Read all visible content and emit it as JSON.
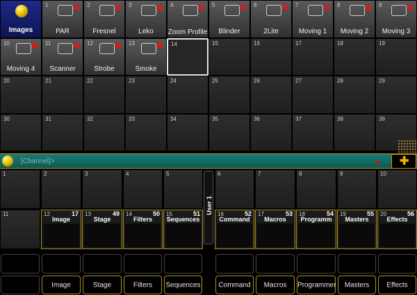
{
  "pool": {
    "images_label": "Images",
    "row1": [
      {
        "num": "1",
        "label": "PAR"
      },
      {
        "num": "2",
        "label": "Fresnel"
      },
      {
        "num": "3",
        "label": "Leko"
      },
      {
        "num": "4",
        "label": "Zoom Profile"
      },
      {
        "num": "5",
        "label": "Blinder"
      },
      {
        "num": "6",
        "label": "2Lite"
      },
      {
        "num": "7",
        "label": "Moving 1"
      },
      {
        "num": "8",
        "label": "Moving 2"
      },
      {
        "num": "9",
        "label": "Moving 3"
      }
    ],
    "row2": [
      {
        "num": "10",
        "label": "Moving 4"
      },
      {
        "num": "11",
        "label": "Scanner"
      },
      {
        "num": "12",
        "label": "Strobe"
      },
      {
        "num": "13",
        "label": "Smoke"
      },
      {
        "num": "14",
        "label": ""
      },
      {
        "num": "15",
        "label": ""
      },
      {
        "num": "16",
        "label": ""
      },
      {
        "num": "17",
        "label": ""
      },
      {
        "num": "18",
        "label": ""
      },
      {
        "num": "19",
        "label": ""
      }
    ],
    "row3": [
      "20",
      "21",
      "22",
      "23",
      "24",
      "25",
      "26",
      "27",
      "28",
      "29"
    ],
    "row4": [
      "30",
      "31",
      "32",
      "33",
      "34",
      "35",
      "36",
      "37",
      "38",
      "39"
    ]
  },
  "command_line": {
    "prompt": "[Channel]>"
  },
  "views_top": [
    "1",
    "2",
    "3",
    "4",
    "5",
    "6",
    "7",
    "8",
    "9",
    "10"
  ],
  "views_bottom": [
    {
      "num": "11",
      "title": "",
      "idx": ""
    },
    {
      "num": "12",
      "title": "Image",
      "idx": "17"
    },
    {
      "num": "13",
      "title": "Stage",
      "idx": "49"
    },
    {
      "num": "14",
      "title": "Filters",
      "idx": "50"
    },
    {
      "num": "15",
      "title": "Sequences",
      "idx": "51"
    },
    {
      "num": "16",
      "title": "Command",
      "idx": "52"
    },
    {
      "num": "17",
      "title": "Macros",
      "idx": "53"
    },
    {
      "num": "18",
      "title": "Programm",
      "idx": "54"
    },
    {
      "num": "19",
      "title": "Masters",
      "idx": "55"
    },
    {
      "num": "20",
      "title": "Effects",
      "idx": "56"
    }
  ],
  "user_label": "User 1",
  "bottom_buttons": [
    "",
    "Image",
    "Stage",
    "Filters",
    "Sequences",
    "Command",
    "Macros",
    "Programmer",
    "Masters",
    "Effects"
  ],
  "colors": {
    "accent": "#b09020",
    "lock": "#e01818",
    "cmdbar": "#0e5a55",
    "images_bg": "#1c2a8a"
  }
}
